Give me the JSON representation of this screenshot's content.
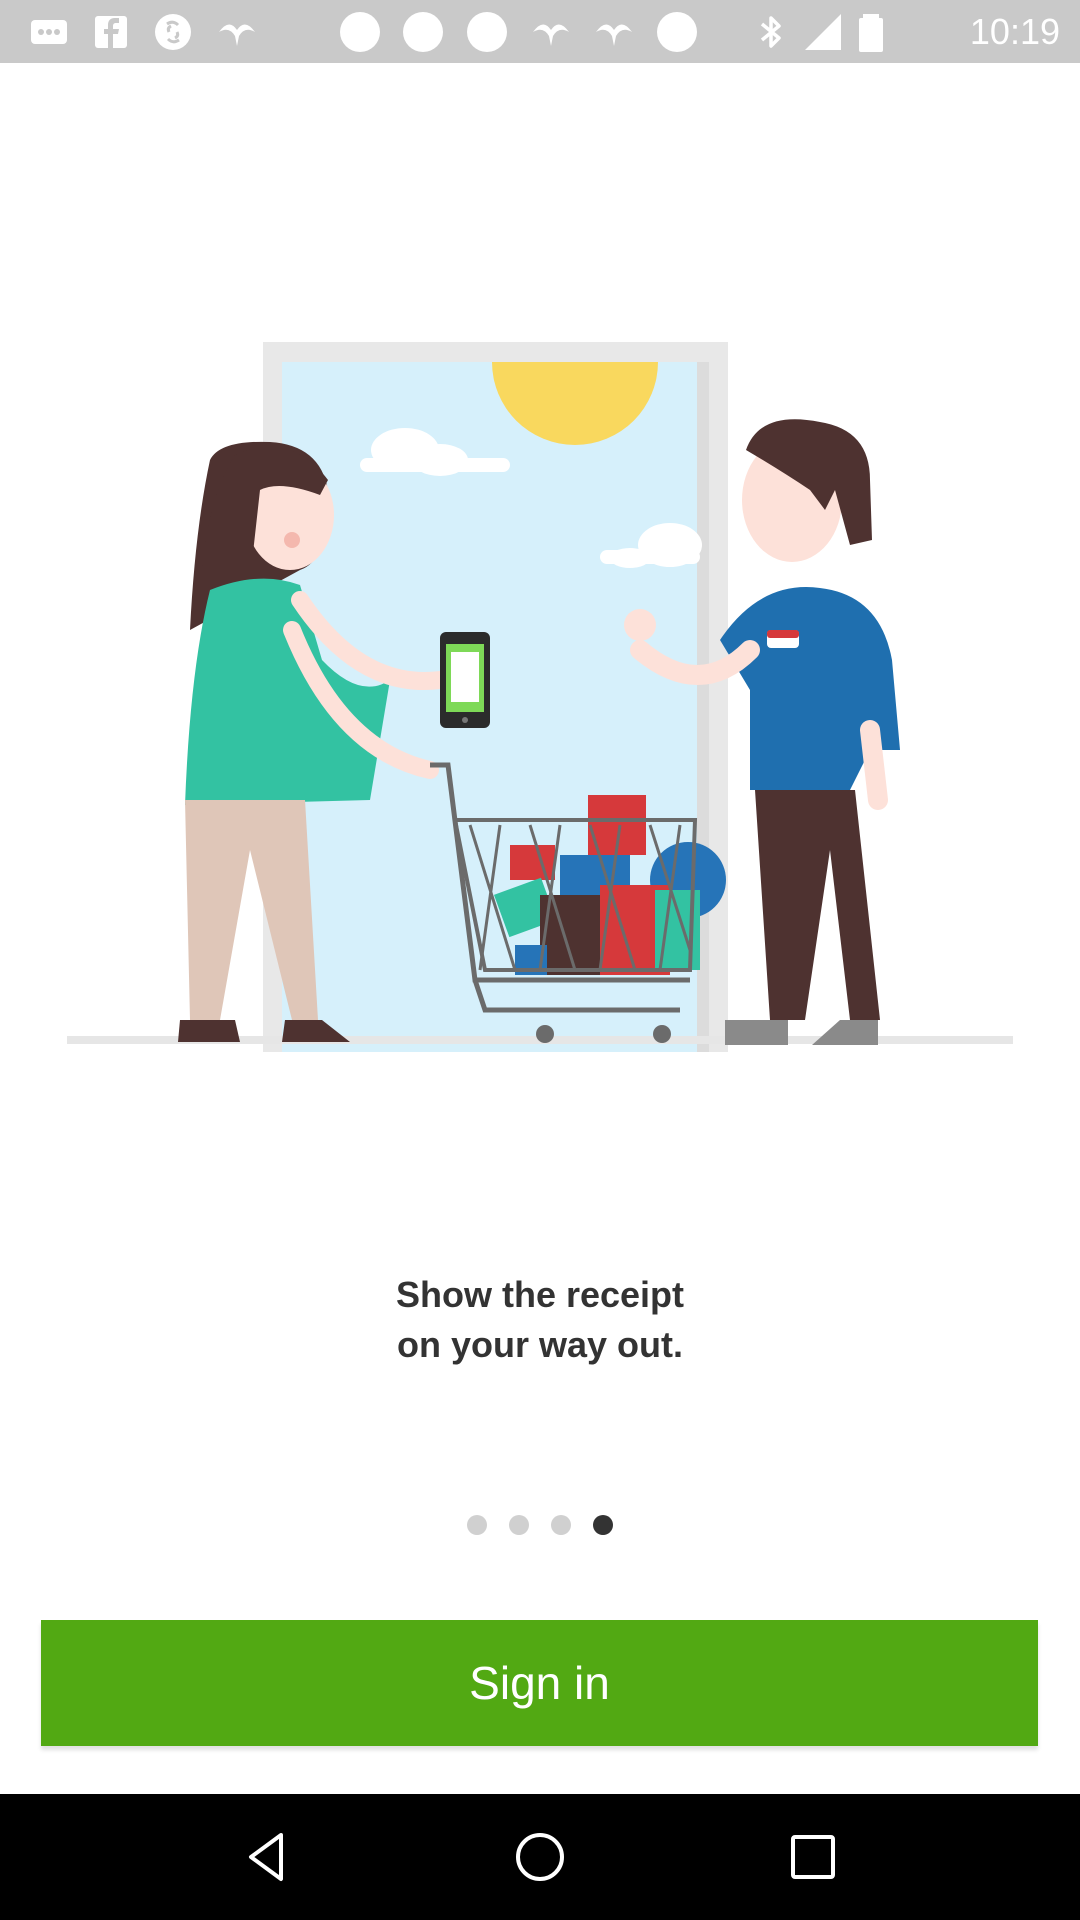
{
  "status_bar": {
    "time": "10:19",
    "icons": [
      "more-icon",
      "facebook-icon",
      "shazam-icon",
      "bird-icon",
      "circle-icon",
      "circle-icon",
      "circle-icon",
      "bird-icon",
      "bird-icon",
      "circle-icon",
      "bluetooth-icon",
      "signal-icon",
      "battery-icon"
    ]
  },
  "onboarding": {
    "caption_line1": "Show the receipt",
    "caption_line2": "on your way out.",
    "page_count": 4,
    "active_page": 4
  },
  "actions": {
    "sign_in_label": "Sign in"
  },
  "colors": {
    "accent": "#52a913",
    "status_bar_bg": "#c9c9c9",
    "caption_text": "#333333",
    "dot_active": "#333333",
    "dot_inactive": "#d0d0d0"
  },
  "nav": {
    "back": "back-icon",
    "home": "home-icon",
    "recents": "recents-icon"
  }
}
